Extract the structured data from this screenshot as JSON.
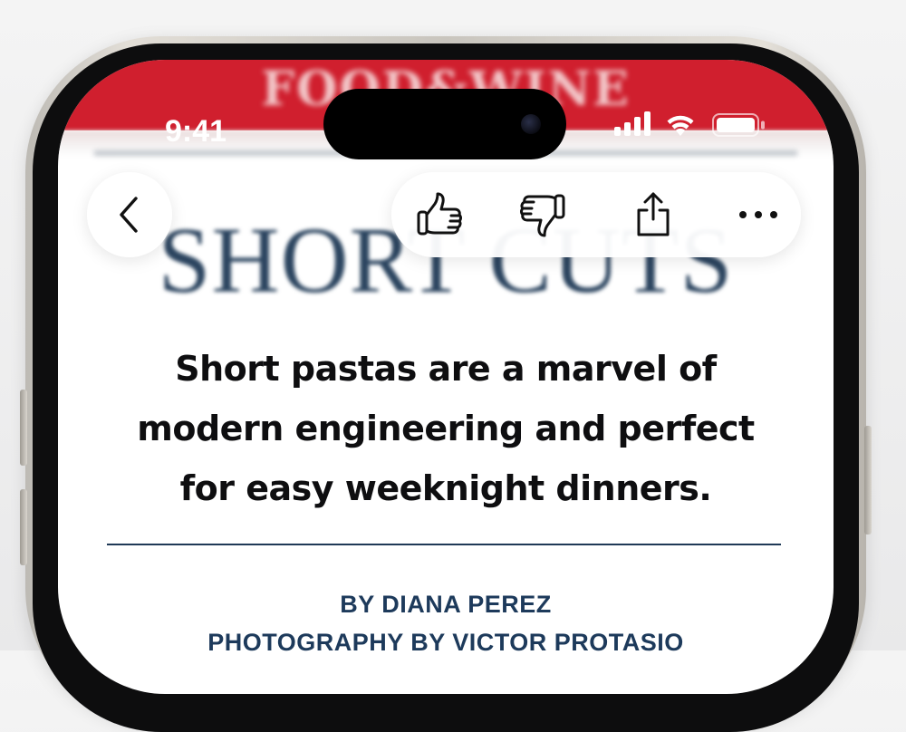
{
  "status_bar": {
    "time": "9:41"
  },
  "article": {
    "masthead": "FOOD&WINE",
    "hero_title": "SHORT CUTS",
    "headline_lines": [
      "Short pastas are a marvel of",
      "modern engineering and perfect",
      "for easy weeknight dinners."
    ],
    "byline": "BY DIANA PEREZ",
    "photo_credit": "PHOTOGRAPHY BY VICTOR PROTASIO"
  },
  "toolbar": {
    "back_icon": "chevron-left-icon",
    "actions": [
      "thumbs-up-icon",
      "thumbs-down-icon",
      "share-icon",
      "more-icon"
    ]
  },
  "colors": {
    "masthead_red": "#d01f2e",
    "title_navy": "#2c4560",
    "byline_navy": "#1d3a5b"
  }
}
